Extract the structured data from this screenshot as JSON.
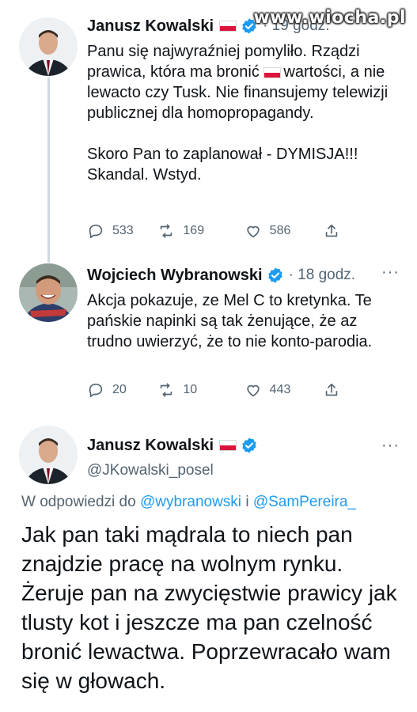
{
  "watermark": "www.wiocha.pl",
  "tweets": [
    {
      "name": "Janusz Kowalski",
      "meta": "· 19 godz.",
      "body_parts": [
        "Panu się najwyraźniej pomyliło. Rządzi prawica, która ma bronić ",
        "wartości, a nie lewacto czy Tusk. Nie finansujemy telewizji publicznej dla homopropagandy.\n\nSkoro Pan to zaplanował - DYMISJA!!! Skandal. Wstyd."
      ],
      "replies": "533",
      "retweets": "169",
      "likes": "586"
    },
    {
      "name": "Wojciech Wybranowski",
      "meta": "· 18 godz.",
      "more": "···",
      "body": "Akcja pokazuje, ze Mel C to kretynka. Te pańskie napinki są tak żenujące, że az trudno uwierzyć, że to nie konto-parodia.",
      "replies": "20",
      "retweets": "10",
      "likes": "443"
    }
  ],
  "main_tweet": {
    "name": "Janusz Kowalski",
    "handle": "@JKowalski_posel",
    "more": "···",
    "reply_prefix": "W odpowiedzi do",
    "reply_user1": "@wybranowski",
    "reply_and": "i",
    "reply_user2": "@SamPereira_",
    "text": "Jak pan taki mądrala to niech pan znajdzie pracę na wolnym rynku. Żeruje pan na zwycięstwie prawicy jak tlusty kot i jeszcze ma pan czelność bronić lewactwa. Poprzewracało wam się w głowach."
  },
  "colors": {
    "accent": "#1d9bf0",
    "muted": "#536471",
    "flag_red": "#dc143c",
    "thread_line": "#cfd9de"
  },
  "icons": [
    "reply-icon",
    "retweet-icon",
    "like-icon",
    "share-icon",
    "verified-badge-icon",
    "poland-flag-icon",
    "more-icon"
  ]
}
